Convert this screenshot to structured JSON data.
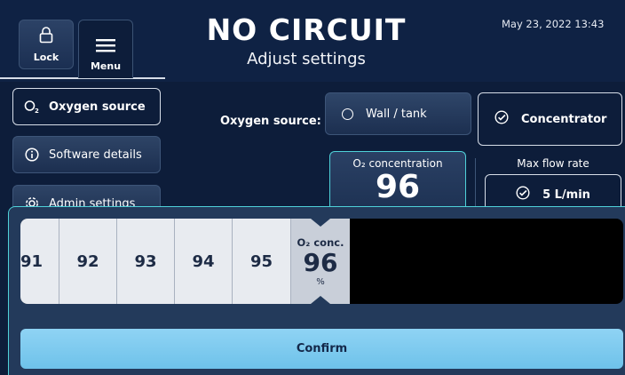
{
  "header": {
    "lock_label": "Lock",
    "menu_label": "Menu",
    "title": "NO CIRCUIT",
    "subtitle": "Adjust settings",
    "datetime": "May 23, 2022 13:43"
  },
  "sidebar": {
    "items": [
      {
        "label": "Oxygen source",
        "icon": "o2-icon",
        "active": true
      },
      {
        "label": "Software details",
        "icon": "info-icon",
        "active": false
      },
      {
        "label": "Admin settings",
        "icon": "gear-icon",
        "active": false
      }
    ]
  },
  "oxygen_source": {
    "label": "Oxygen source:",
    "options": [
      {
        "label": "Wall / tank",
        "selected": false
      },
      {
        "label": "Concentrator",
        "selected": true
      }
    ]
  },
  "o2_concentration": {
    "label": "O₂ concentration",
    "value": "96",
    "unit": "%"
  },
  "max_flow": {
    "label": "Max flow rate",
    "value": "5 L/min"
  },
  "picker": {
    "values": [
      "91",
      "92",
      "93",
      "94",
      "95"
    ],
    "selected": {
      "label": "O₂ conc.",
      "value": "96",
      "unit": "%"
    }
  },
  "confirm_label": "Confirm",
  "colors": {
    "background": "#0d1d3a",
    "accent": "#4fd1d9",
    "confirm": "#8fd3f4"
  }
}
